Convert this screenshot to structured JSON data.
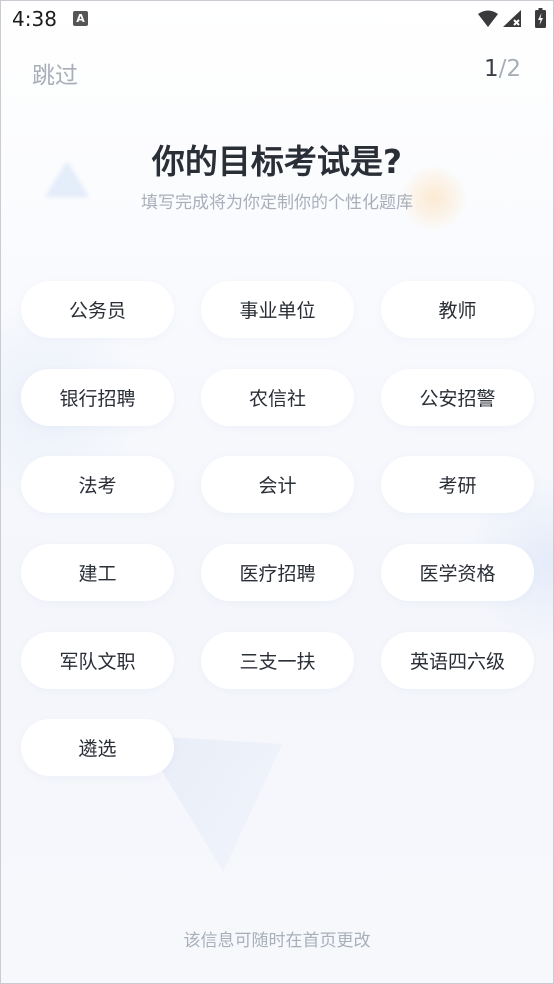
{
  "status_bar": {
    "time": "4:38",
    "notification_icon": "a-icon",
    "wifi_icon": "wifi-icon",
    "signal_icon": "signal-icon",
    "battery_icon": "battery-icon"
  },
  "header": {
    "skip_label": "跳过",
    "progress_current": "1",
    "progress_separator": "/",
    "progress_total": "2"
  },
  "title": "你的目标考试是?",
  "subtitle": "填写完成将为你定制你的个性化题库",
  "options": [
    {
      "label": "公务员"
    },
    {
      "label": "事业单位"
    },
    {
      "label": "教师"
    },
    {
      "label": "银行招聘"
    },
    {
      "label": "农信社"
    },
    {
      "label": "公安招警"
    },
    {
      "label": "法考"
    },
    {
      "label": "会计"
    },
    {
      "label": "考研"
    },
    {
      "label": "建工"
    },
    {
      "label": "医疗招聘"
    },
    {
      "label": "医学资格"
    },
    {
      "label": "军队文职"
    },
    {
      "label": "三支一扶"
    },
    {
      "label": "英语四六级"
    },
    {
      "label": "遴选"
    }
  ],
  "footer_note": "该信息可随时在首页更改",
  "colors": {
    "title": "#2a2e36",
    "muted": "#a9afba",
    "chip_bg": "#ffffff"
  }
}
